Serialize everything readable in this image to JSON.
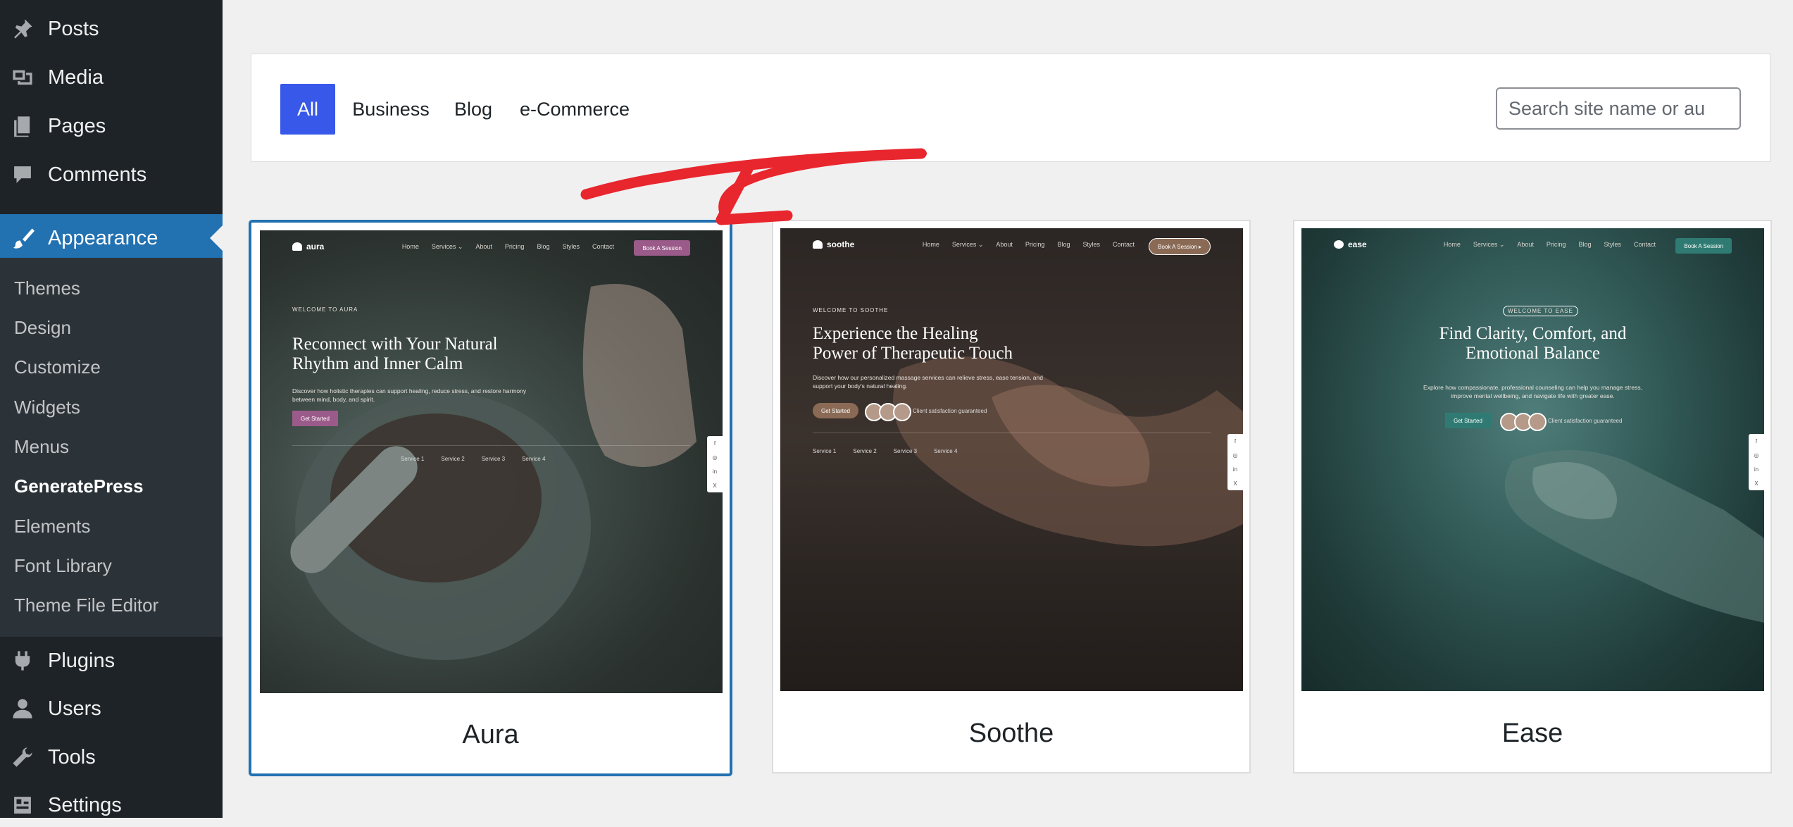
{
  "sidebar": {
    "top_items": [
      {
        "label": "Posts",
        "icon": "pin-icon"
      },
      {
        "label": "Media",
        "icon": "media-icon"
      },
      {
        "label": "Pages",
        "icon": "pages-icon"
      },
      {
        "label": "Comments",
        "icon": "comments-icon"
      }
    ],
    "current": {
      "label": "Appearance",
      "icon": "paintbrush-icon"
    },
    "submenu": [
      "Themes",
      "Design",
      "Customize",
      "Widgets",
      "Menus",
      "GeneratePress",
      "Elements",
      "Font Library",
      "Theme File Editor"
    ],
    "bottom_items": [
      {
        "label": "Plugins",
        "icon": "plugins-icon"
      },
      {
        "label": "Users",
        "icon": "users-icon"
      },
      {
        "label": "Tools",
        "icon": "tools-icon"
      },
      {
        "label": "Settings",
        "icon": "settings-icon"
      }
    ]
  },
  "filters": {
    "tabs": [
      "All",
      "Business",
      "Blog",
      "e-Commerce"
    ],
    "active": "All",
    "search_placeholder": "Search site name or au"
  },
  "sites": [
    {
      "title": "Aura",
      "selected": true,
      "brand": "aura",
      "nav": [
        "Home",
        "Services ⌄",
        "About",
        "Pricing",
        "Blog",
        "Styles",
        "Contact"
      ],
      "cta": "Book A Session",
      "kicker": "WELCOME TO AURA",
      "headline": [
        "Reconnect with Your Natural",
        "Rhythm and Inner Calm"
      ],
      "text": [
        "Discover how holistic therapies can support healing, reduce stress, and restore harmony",
        "between mind, body, and spirit."
      ],
      "button": "Get Started",
      "services": [
        "Service 1",
        "Service 2",
        "Service 3",
        "Service 4"
      ],
      "accent": "#9b5b8a"
    },
    {
      "title": "Soothe",
      "selected": false,
      "brand": "soothe",
      "nav": [
        "Home",
        "Services ⌄",
        "About",
        "Pricing",
        "Blog",
        "Styles",
        "Contact"
      ],
      "cta": "Book A Session ▸",
      "kicker": "WELCOME TO SOOTHE",
      "headline": [
        "Experience the Healing",
        "Power of Therapeutic Touch"
      ],
      "text": [
        "Discover how our personalized massage services can relieve stress, ease tension, and",
        "support your body's natural healing."
      ],
      "button": "Get Started",
      "guarantee": "Client satisfaction guaranteed",
      "services": [
        "Service 1",
        "Service 2",
        "Service 3",
        "Service 4"
      ],
      "accent": "#8a6a55"
    },
    {
      "title": "Ease",
      "selected": false,
      "brand": "ease",
      "nav": [
        "Home",
        "Services ⌄",
        "About",
        "Pricing",
        "Blog",
        "Styles",
        "Contact"
      ],
      "cta": "Book A Session",
      "kicker": "WELCOME TO EASE",
      "headline": [
        "Find Clarity, Comfort, and",
        "Emotional Balance"
      ],
      "text": [
        "Explore how compassionate, professional counseling can help you manage stress,",
        "improve mental wellbeing, and navigate life with greater ease."
      ],
      "button": "Get Started",
      "guarantee": "Client satisfaction guaranteed",
      "accent": "#2f7b73"
    }
  ],
  "colors": {
    "sidebar_bg": "#1d2327",
    "submenu_bg": "#2c3338",
    "current_bg": "#2271b1",
    "tab_active": "#3858e9",
    "arrow": "#e8262d"
  }
}
